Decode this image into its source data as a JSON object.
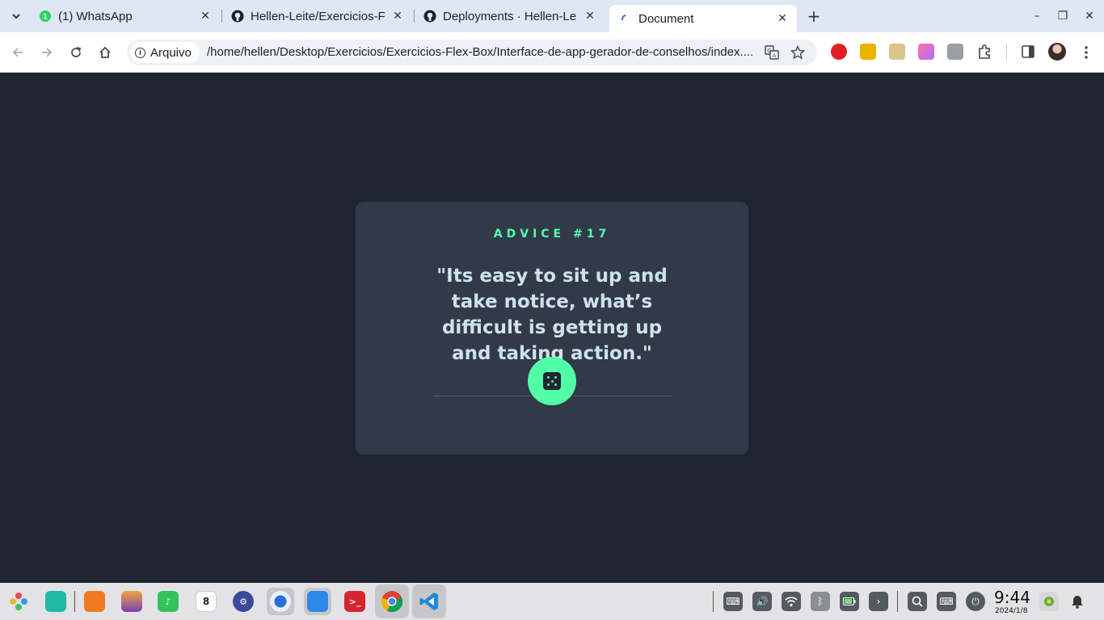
{
  "browser": {
    "tabs": [
      {
        "title": "(1) WhatsApp",
        "favicon": "whatsapp-icon",
        "active": false
      },
      {
        "title": "Hellen-Leite/Exercicios-F",
        "favicon": "github-icon",
        "active": false
      },
      {
        "title": "Deployments · Hellen-Le",
        "favicon": "github-icon",
        "active": false
      },
      {
        "title": "Document",
        "favicon": "page-loading-icon",
        "active": true
      }
    ],
    "new_tab": "+",
    "window_controls": {
      "minimize": "–",
      "restore": "❐",
      "close": "✕"
    },
    "address": {
      "security_label": "Arquivo",
      "url": "/home/hellen/Desktop/Exercicios/Exercicios-Flex-Box/Interface-de-app-gerador-de-conselhos/index...."
    }
  },
  "card": {
    "advice_id": "ADVICE #17",
    "quote": "\"Its easy to sit up and take notice, what’s difficult is getting up and taking action.\"",
    "accent_color": "#52ffa8",
    "card_color": "#323a49",
    "text_color": "#cee3e9"
  },
  "taskbar": {
    "calendar_day": "8",
    "clock_time": "9:44",
    "clock_date": "2024/1/8"
  }
}
